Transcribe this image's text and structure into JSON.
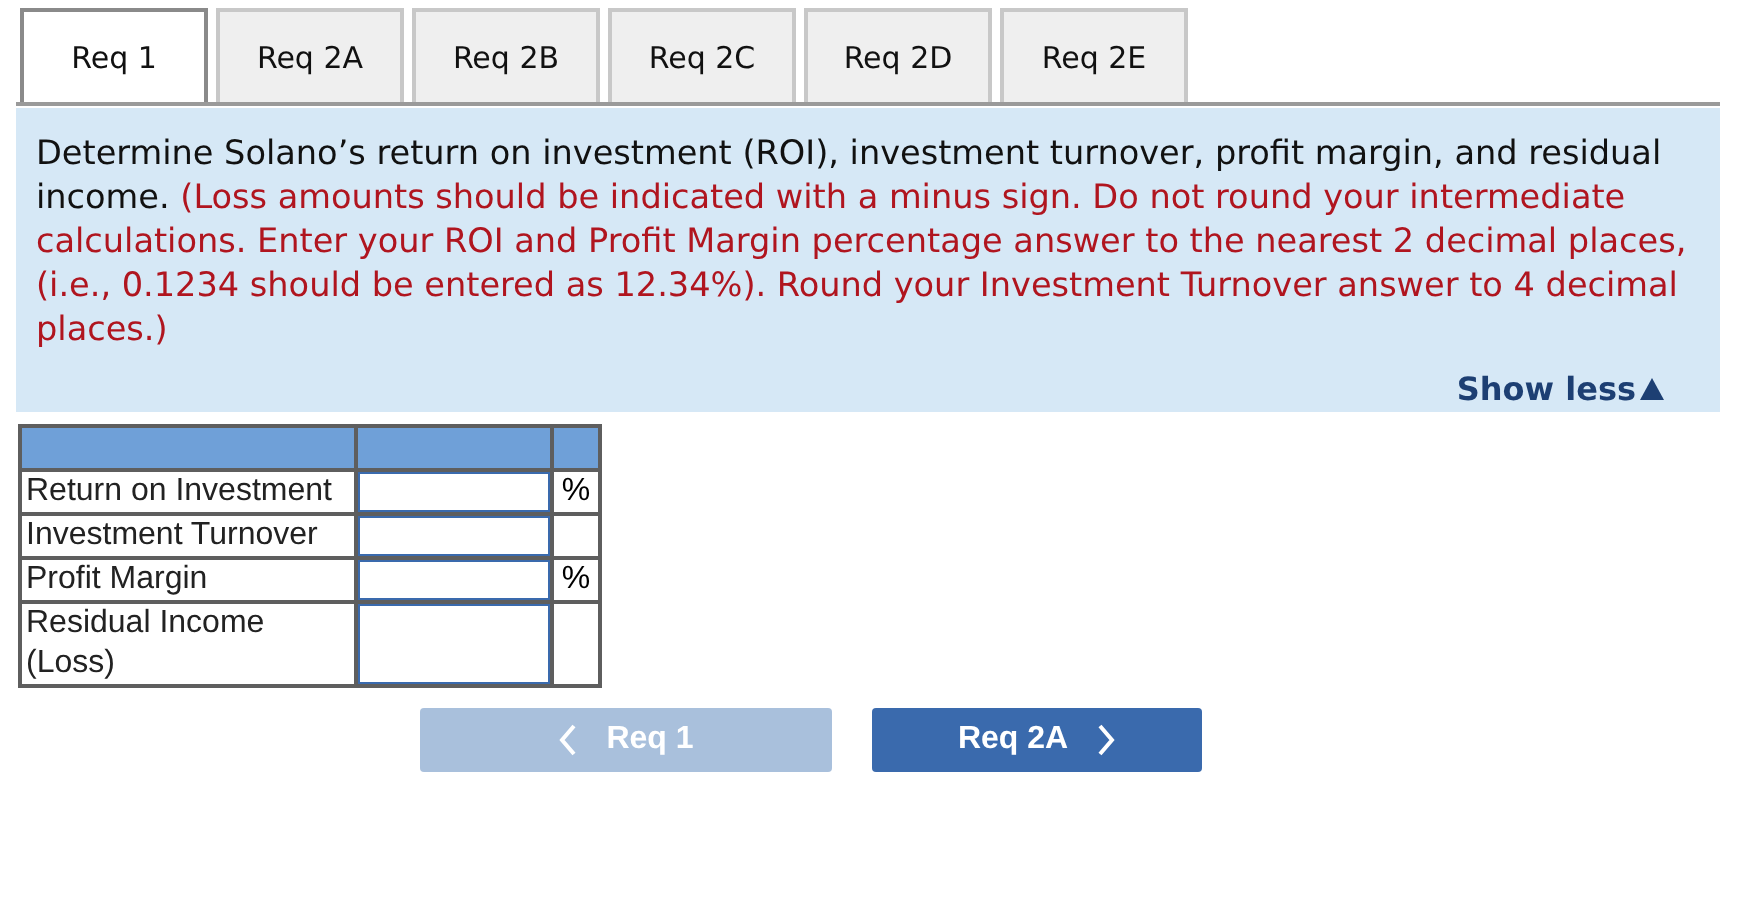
{
  "tabs": [
    {
      "label": "Req 1",
      "selected": true
    },
    {
      "label": "Req 2A",
      "selected": false
    },
    {
      "label": "Req 2B",
      "selected": false
    },
    {
      "label": "Req 2C",
      "selected": false
    },
    {
      "label": "Req 2D",
      "selected": false
    },
    {
      "label": "Req 2E",
      "selected": false
    }
  ],
  "instructions": {
    "text": "Determine Solano’s return on investment (ROI), investment turnover, profit margin, and residual income.",
    "note": "(Loss amounts should be indicated with a minus sign. Do not round your intermediate calculations. Enter your ROI and Profit Margin percentage answer to the nearest 2 decimal places, (i.e., 0.1234 should be entered as 12.34%). Round your Investment Turnover answer to 4 decimal places.)",
    "toggle": "Show less"
  },
  "table": {
    "rows": [
      {
        "label": "Return on Investment",
        "unit": "%"
      },
      {
        "label": "Investment Turnover"
      },
      {
        "label": "Profit Margin",
        "unit": "%"
      },
      {
        "label": "Residual Income (Loss)"
      }
    ]
  },
  "nav": [
    {
      "label": "Req 1",
      "kind": "prev",
      "disabled": true
    },
    {
      "label": "Req 2A",
      "kind": "next",
      "disabled": false
    }
  ]
}
